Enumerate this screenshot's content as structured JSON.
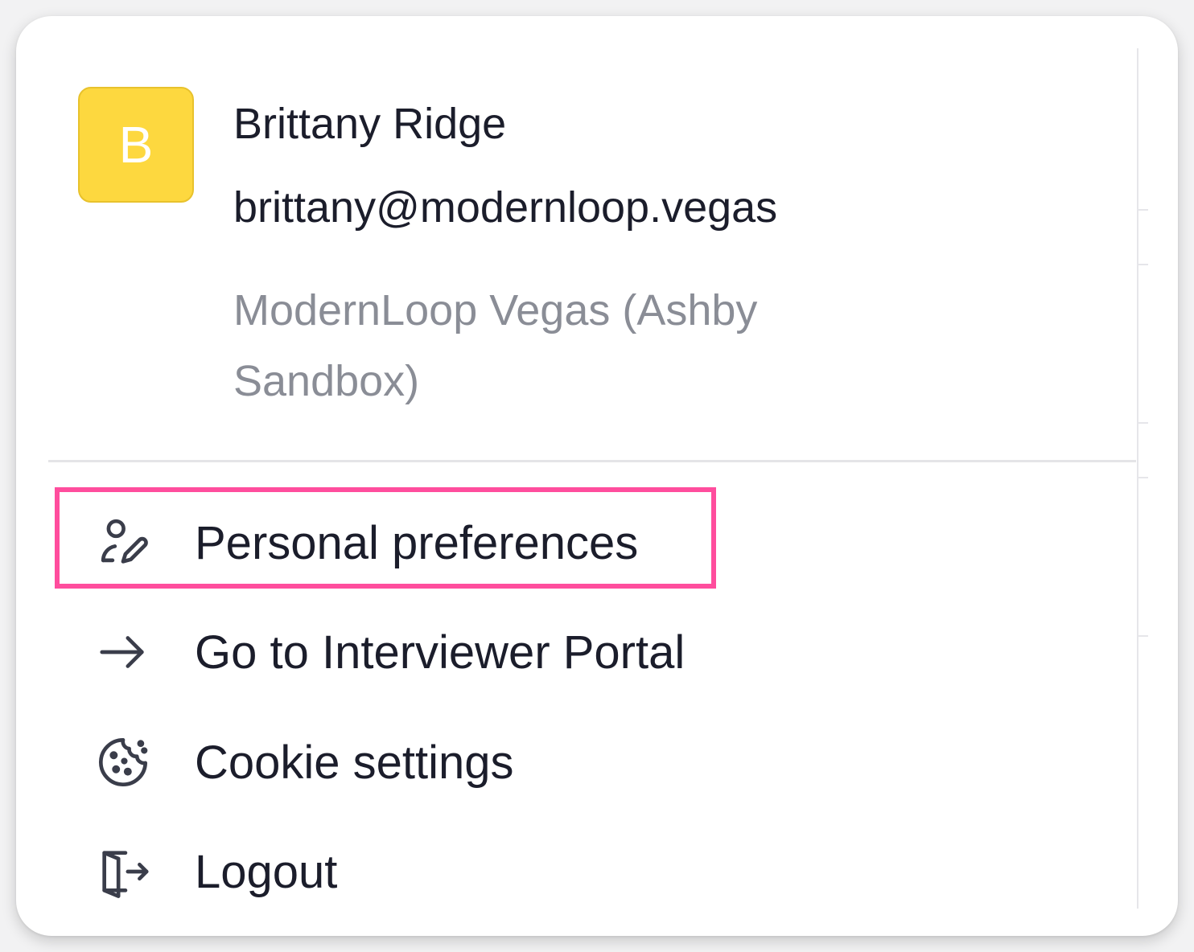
{
  "user": {
    "avatar_initial": "B",
    "name": "Brittany Ridge",
    "email": "brittany@modernloop.vegas",
    "organization": "ModernLoop Vegas (Ashby Sandbox)"
  },
  "menu": {
    "items": [
      {
        "label": "Personal preferences",
        "icon": "user-edit-icon"
      },
      {
        "label": "Go to Interviewer Portal",
        "icon": "arrow-right-icon"
      },
      {
        "label": "Cookie settings",
        "icon": "cookie-icon"
      },
      {
        "label": "Logout",
        "icon": "logout-icon"
      }
    ]
  },
  "colors": {
    "avatar_bg": "#fdd83f",
    "highlight": "#ff4d9d",
    "text_primary": "#1b1d2b",
    "text_secondary": "#8a8d96"
  }
}
